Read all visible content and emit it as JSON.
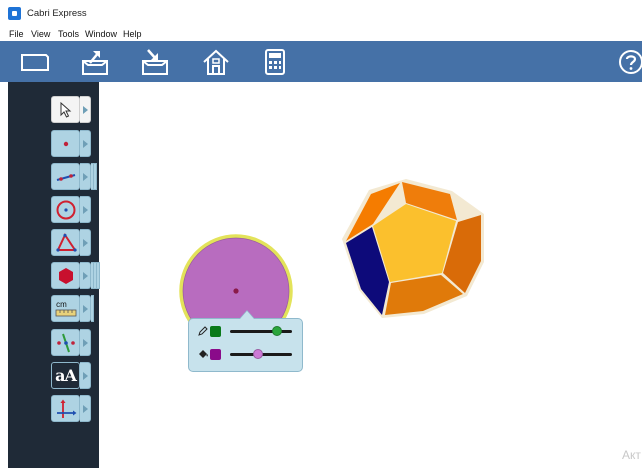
{
  "window": {
    "title": "Cabri Express"
  },
  "menu": {
    "items": [
      "File",
      "View",
      "Tools",
      "Window",
      "Help"
    ]
  },
  "toolbar": {
    "buttons": [
      {
        "name": "new-document",
        "icon": "blank-sheet-icon"
      },
      {
        "name": "open-document",
        "icon": "tray-up-arrow-icon"
      },
      {
        "name": "save-document",
        "icon": "tray-down-arrow-icon"
      },
      {
        "name": "home",
        "icon": "home-icon"
      },
      {
        "name": "calculator",
        "icon": "calculator-icon"
      },
      {
        "name": "help",
        "icon": "help-circle-icon"
      }
    ],
    "color": "#4571a7"
  },
  "tools": [
    {
      "name": "pointer",
      "icon": "cursor-arrow-icon",
      "active": true
    },
    {
      "name": "point",
      "icon": "point-icon"
    },
    {
      "name": "line",
      "icon": "line-icon"
    },
    {
      "name": "circle",
      "icon": "circle-icon"
    },
    {
      "name": "triangle",
      "icon": "triangle-icon"
    },
    {
      "name": "polygon",
      "icon": "polygon-fill-icon"
    },
    {
      "name": "measure",
      "icon": "ruler-cm-icon",
      "label": "cm"
    },
    {
      "name": "transform",
      "icon": "symmetry-icon"
    },
    {
      "name": "text",
      "icon": "text-icon",
      "label": "aA"
    },
    {
      "name": "axes",
      "icon": "axes-icon"
    }
  ],
  "canvas": {
    "circle": {
      "fill": "#b86cbf",
      "outline": "#e3e35a",
      "center_point": "#8a1a4a"
    },
    "dodecahedron": {
      "face_colors": {
        "front": "#fbc02d",
        "upper_left": "#f57c00",
        "upper_right": "#ef7d0b",
        "right": "#d96b08",
        "bottom": "#e07a0a",
        "left": "#0d0a7a"
      },
      "edge_color": "#f3e9d2"
    }
  },
  "style_popup": {
    "line_color": "#0a7a1a",
    "line_slider_color": "#2aa53c",
    "line_value": 0.75,
    "fill_color": "#8a0a8a",
    "fill_slider_color": "#cc7ad6",
    "fill_value": 0.45,
    "line_icon": "pencil-icon",
    "fill_icon": "paint-bucket-icon"
  },
  "watermark": {
    "text": "Акт"
  }
}
